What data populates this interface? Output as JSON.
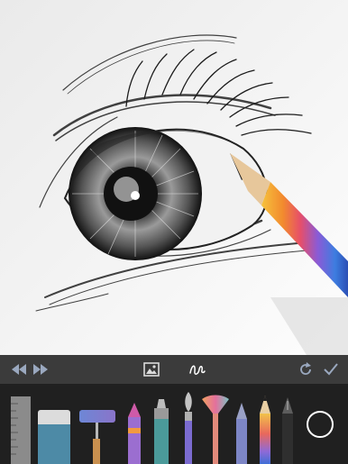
{
  "app": {
    "toolbar": {
      "undo_icon": "undo-icon",
      "redo_icon": "redo-icon",
      "image_icon": "image-icon",
      "stroke_icon": "stroke-icon",
      "refresh_icon": "refresh-icon",
      "confirm_icon": "checkmark-icon"
    },
    "tools": [
      "ruler",
      "eraser",
      "paint-roller",
      "crayon",
      "marker",
      "paint-brush",
      "fan-brush",
      "soft-pencil",
      "pencil",
      "ink-pen"
    ],
    "current_color": "#ffffff",
    "accent_colors": {
      "toolbar_bg": "#3b3b3b",
      "tray_bg": "#202020"
    }
  }
}
